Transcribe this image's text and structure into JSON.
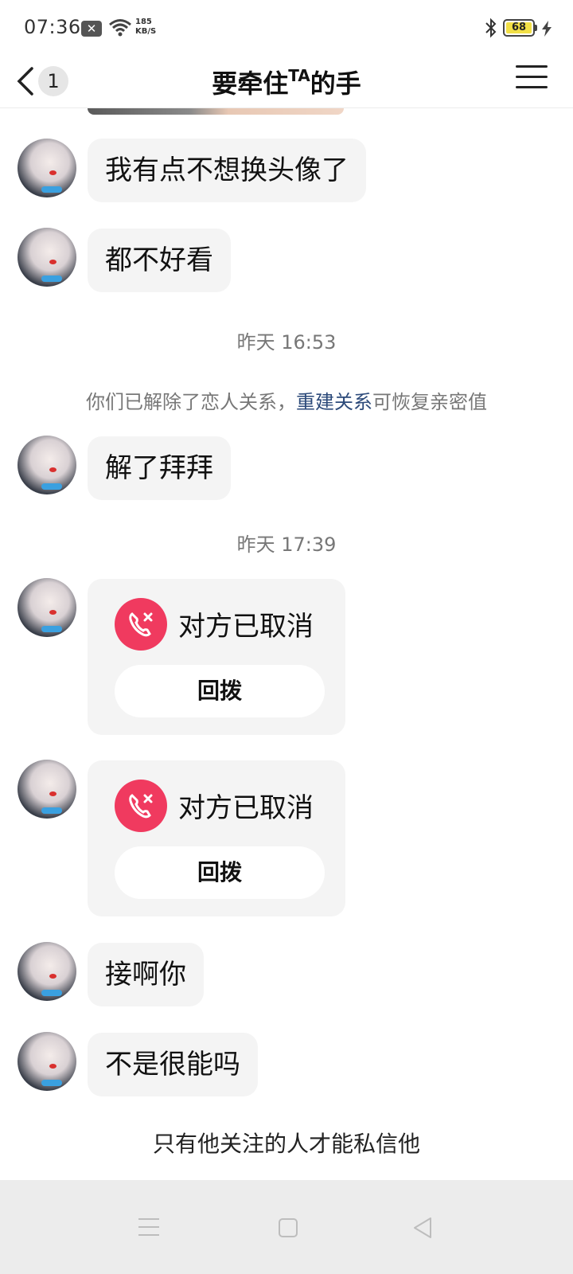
{
  "status_bar": {
    "time": "07:36",
    "net_speed_value": "185",
    "net_speed_unit": "KB/S",
    "battery_level": "68",
    "icons": [
      "notification-icon",
      "wifi-icon",
      "bluetooth-icon",
      "battery-icon",
      "charging-icon"
    ]
  },
  "header": {
    "unread_count": "1",
    "title_main": "要牵住",
    "title_sup": "TA",
    "title_end": "的手"
  },
  "messages": {
    "m1": "我有点不想换头像了",
    "m2": "都不好看",
    "ts1": "昨天 16:53",
    "system_before": "你们已解除了恋人关系，",
    "system_link": "重建关系",
    "system_after": "可恢复亲密值",
    "m3": "解了拜拜",
    "ts2": "昨天 17:39",
    "call1_status": "对方已取消",
    "call1_button": "回拨",
    "call2_status": "对方已取消",
    "call2_button": "回拨",
    "m4": "接啊你",
    "m5": "不是很能吗"
  },
  "footer": {
    "restriction": "只有他关注的人才能私信他"
  },
  "colors": {
    "call_icon": "#f03a5f",
    "link": "#2c4a7a",
    "bubble": "#f4f4f4"
  }
}
